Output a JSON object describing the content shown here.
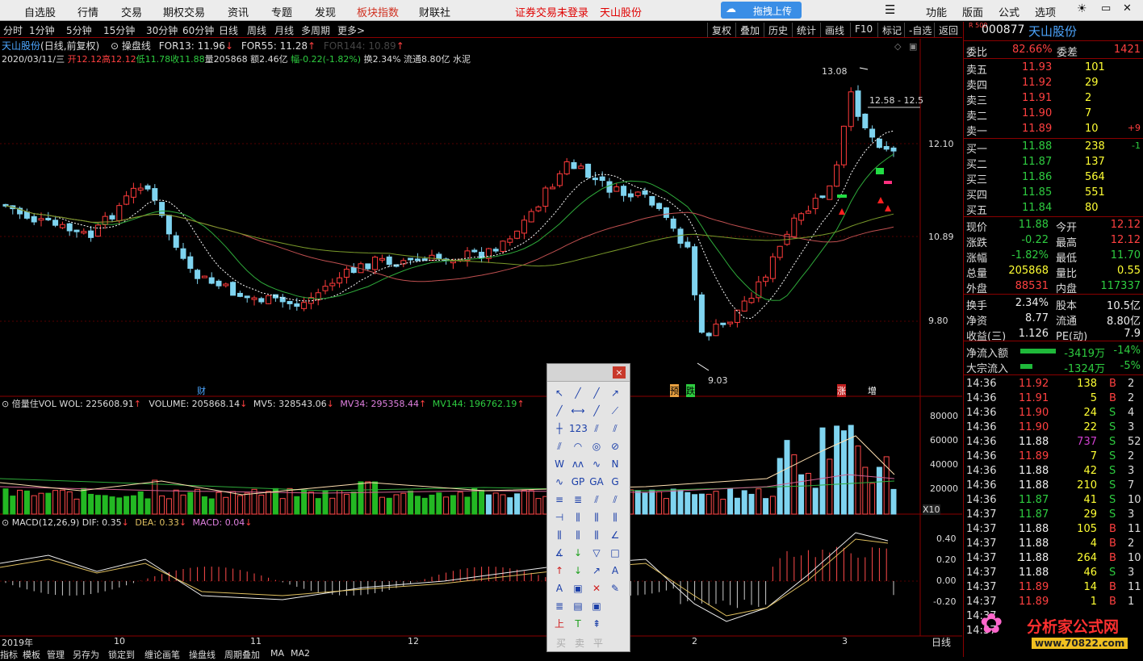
{
  "topbar": {
    "items": [
      "自选股",
      "行情",
      "交易",
      "期权交易",
      "资讯",
      "专题",
      "发现",
      "板块指数",
      "财联社"
    ],
    "notice1": "证券交易未登录",
    "notice2": "天山股份",
    "upload": "拖拽上传",
    "right": [
      "功能",
      "版面",
      "公式",
      "选项"
    ]
  },
  "subtool": {
    "periods": [
      "分时",
      "1分钟",
      "5分钟",
      "15分钟",
      "30分钟",
      "60分钟",
      "日线",
      "周线",
      "月线",
      "多周期",
      "更多>"
    ],
    "buttons": [
      "复权",
      "叠加",
      "历史",
      "统计",
      "画线",
      "F10",
      "标记",
      "-自选",
      "返回"
    ]
  },
  "chart": {
    "name": "天山股份",
    "mode": "(日线,前复权)",
    "indicator": "操盘线",
    "for13": "FOR13: 11.96",
    "for55": "FOR55: 11.28",
    "for144": "FOR144: 10.89",
    "info_date": "2020/03/11/三",
    "info_open": "开12.12",
    "info_high": "高12.12",
    "info_low": "低11.78",
    "info_close": "收11.88",
    "info_vol": "量205868",
    "info_amt": "额2.46亿",
    "info_chg": "幅-0.22(-1.82%)",
    "info_turn": "换2.34%",
    "info_flow": "流通8.80亿",
    "info_cat": "水泥",
    "price_labels": [
      "12.10",
      "10.89",
      "9.80"
    ],
    "high_mark": "13.08",
    "low_mark": "9.03",
    "range_mark": "12.58 - 12.5",
    "events": [
      "财",
      "预",
      "跌",
      "涨",
      "增"
    ]
  },
  "volume": {
    "title": "倍量住VOL",
    "wol": "WOL: 225608.91",
    "volume": "VOLUME: 205868.14",
    "mv5": "MV5: 328543.06",
    "mv34": "MV34: 295358.44",
    "mv144": "MV144: 196762.19",
    "labels": [
      "80000",
      "60000",
      "40000",
      "20000"
    ],
    "x10": "X10"
  },
  "macd": {
    "title": "MACD(12,26,9)",
    "dif": "DIF: 0.35",
    "dea": "DEA: 0.33",
    "macd": "MACD: 0.04",
    "labels": [
      "0.40",
      "0.20",
      "0.00",
      "-0.20"
    ]
  },
  "xaxis": {
    "labels": [
      "2019年",
      "10",
      "11",
      "12",
      "2",
      "3"
    ],
    "period": "日线"
  },
  "bottom_tabs": [
    "指标",
    "模板",
    "管理",
    "另存为",
    "锁定到",
    "缠论画笔",
    "操盘线",
    "周期叠加",
    "MA",
    "MA2"
  ],
  "palette": {
    "trade": [
      "买",
      "卖",
      "平"
    ]
  },
  "quote": {
    "code": "000877",
    "name": "天山股份",
    "market": "R 500",
    "wb_label": "委比",
    "wb": "82.66%",
    "wc_label": "委差",
    "wc": "1421",
    "sells": [
      {
        "l": "卖五",
        "p": "11.93",
        "v": "101",
        "d": ""
      },
      {
        "l": "卖四",
        "p": "11.92",
        "v": "29",
        "d": ""
      },
      {
        "l": "卖三",
        "p": "11.91",
        "v": "2",
        "d": ""
      },
      {
        "l": "卖二",
        "p": "11.90",
        "v": "7",
        "d": ""
      },
      {
        "l": "卖一",
        "p": "11.89",
        "v": "10",
        "d": "+9"
      }
    ],
    "buys": [
      {
        "l": "买一",
        "p": "11.88",
        "v": "238",
        "d": "-1"
      },
      {
        "l": "买二",
        "p": "11.87",
        "v": "137",
        "d": ""
      },
      {
        "l": "买三",
        "p": "11.86",
        "v": "564",
        "d": ""
      },
      {
        "l": "买四",
        "p": "11.85",
        "v": "551",
        "d": ""
      },
      {
        "l": "买五",
        "p": "11.84",
        "v": "80",
        "d": ""
      }
    ],
    "stats": [
      {
        "a": "现价",
        "av": "11.88",
        "b": "今开",
        "bv": "12.12"
      },
      {
        "a": "涨跌",
        "av": "-0.22",
        "b": "最高",
        "bv": "12.12"
      },
      {
        "a": "涨幅",
        "av": "-1.82%",
        "b": "最低",
        "bv": "11.70"
      },
      {
        "a": "总量",
        "av": "205868",
        "b": "量比",
        "bv": "0.55"
      },
      {
        "a": "外盘",
        "av": "88531",
        "b": "内盘",
        "bv": "117337"
      }
    ],
    "stats2": [
      {
        "a": "换手",
        "av": "2.34%",
        "b": "股本",
        "bv": "10.5亿"
      },
      {
        "a": "净资",
        "av": "8.77",
        "b": "流通",
        "bv": "8.80亿"
      },
      {
        "a": "收益(三)",
        "av": "1.126",
        "b": "PE(动)",
        "bv": "7.9"
      }
    ],
    "flow": [
      {
        "l": "净流入额",
        "v": "-3419万",
        "p": "-14%"
      },
      {
        "l": "大宗流入",
        "v": "-1324万",
        "p": "-5%"
      }
    ],
    "ticks": [
      {
        "t": "14:36",
        "p": "11.92",
        "v": "138",
        "s": "B",
        "n": "2"
      },
      {
        "t": "14:36",
        "p": "11.91",
        "v": "5",
        "s": "B",
        "n": "2"
      },
      {
        "t": "14:36",
        "p": "11.90",
        "v": "24",
        "s": "S",
        "n": "4"
      },
      {
        "t": "14:36",
        "p": "11.90",
        "v": "22",
        "s": "S",
        "n": "3"
      },
      {
        "t": "14:36",
        "p": "11.88",
        "v": "737",
        "s": "S",
        "n": "52"
      },
      {
        "t": "14:36",
        "p": "11.89",
        "v": "7",
        "s": "S",
        "n": "2"
      },
      {
        "t": "14:36",
        "p": "11.88",
        "v": "42",
        "s": "S",
        "n": "3"
      },
      {
        "t": "14:36",
        "p": "11.88",
        "v": "210",
        "s": "S",
        "n": "7"
      },
      {
        "t": "14:36",
        "p": "11.87",
        "v": "41",
        "s": "S",
        "n": "10"
      },
      {
        "t": "14:37",
        "p": "11.87",
        "v": "29",
        "s": "S",
        "n": "3"
      },
      {
        "t": "14:37",
        "p": "11.88",
        "v": "105",
        "s": "B",
        "n": "11"
      },
      {
        "t": "14:37",
        "p": "11.88",
        "v": "4",
        "s": "B",
        "n": "2"
      },
      {
        "t": "14:37",
        "p": "11.88",
        "v": "264",
        "s": "B",
        "n": "10"
      },
      {
        "t": "14:37",
        "p": "11.88",
        "v": "46",
        "s": "S",
        "n": "3"
      },
      {
        "t": "14:37",
        "p": "11.89",
        "v": "14",
        "s": "B",
        "n": "11"
      },
      {
        "t": "14:37",
        "p": "11.89",
        "v": "1",
        "s": "B",
        "n": "1"
      },
      {
        "t": "14:37",
        "p": "",
        "v": "",
        "s": "",
        "n": ""
      },
      {
        "t": "14:37",
        "p": "",
        "v": "",
        "s": "",
        "n": ""
      }
    ]
  },
  "watermark": {
    "text": "分析家公式网",
    "url": "www.70822.com"
  }
}
